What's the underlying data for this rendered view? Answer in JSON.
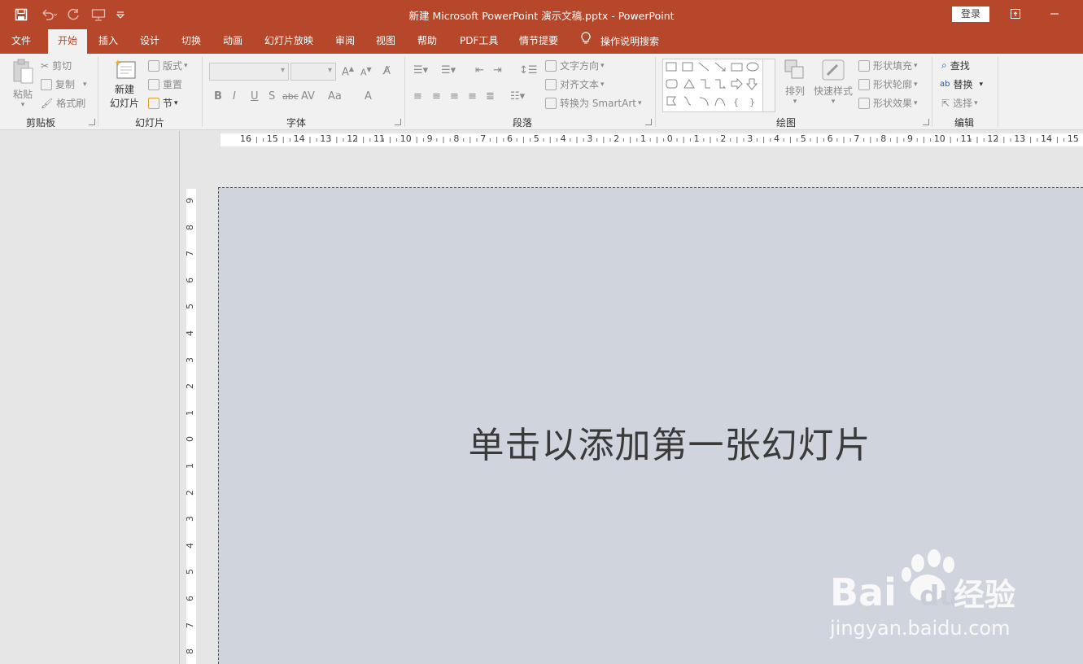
{
  "window": {
    "title": "新建 Microsoft PowerPoint 演示文稿.pptx  -  PowerPoint",
    "login_label": "登录"
  },
  "tabs": [
    "文件",
    "开始",
    "插入",
    "设计",
    "切换",
    "动画",
    "幻灯片放映",
    "审阅",
    "视图",
    "帮助",
    "PDF工具",
    "情节提要"
  ],
  "tellme": "操作说明搜索",
  "ribbon": {
    "clipboard": {
      "label": "剪贴板",
      "paste": "粘贴",
      "cut": "剪切",
      "copy": "复制",
      "format_painter": "格式刷"
    },
    "slides": {
      "label": "幻灯片",
      "new_slide_1": "新建",
      "new_slide_2": "幻灯片",
      "layout": "版式",
      "reset": "重置",
      "section": "节"
    },
    "font": {
      "label": "字体",
      "bold": "B",
      "italic": "I",
      "underline": "U",
      "shadow": "S",
      "strike": "abc",
      "spacing": "AV",
      "case": "Aa",
      "color": "A"
    },
    "paragraph": {
      "label": "段落",
      "text_dir": "文字方向",
      "align_text": "对齐文本",
      "smartart": "转换为 SmartArt"
    },
    "drawing": {
      "label": "绘图",
      "arrange": "排列",
      "quick_styles": "快速样式",
      "fill": "形状填充",
      "outline": "形状轮廓",
      "effects": "形状效果"
    },
    "editing": {
      "label": "编辑",
      "find": "查找",
      "replace": "替换",
      "select": "选择"
    }
  },
  "ruler_h": [
    "16",
    "15",
    "14",
    "13",
    "12",
    "11",
    "10",
    "9",
    "8",
    "7",
    "6",
    "5",
    "4",
    "3",
    "2",
    "1",
    "0",
    "1",
    "2",
    "3",
    "4",
    "5",
    "6",
    "7",
    "8",
    "9",
    "10",
    "11",
    "12",
    "13",
    "14",
    "15"
  ],
  "ruler_v": [
    "9",
    "8",
    "7",
    "6",
    "5",
    "4",
    "3",
    "2",
    "1",
    "0",
    "1",
    "2",
    "3",
    "4",
    "5",
    "6",
    "7",
    "8"
  ],
  "slide": {
    "placeholder": "单击以添加第一张幻灯片"
  },
  "watermark": {
    "brand": "Bai",
    "brand2": "du",
    "cn": "经验",
    "url": "jingyan.baidu.com"
  }
}
